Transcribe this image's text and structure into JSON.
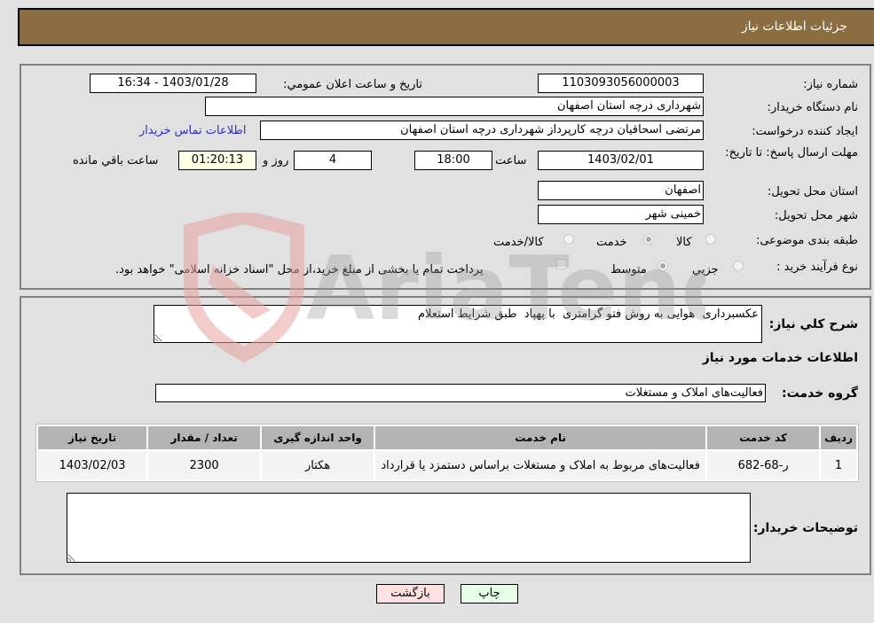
{
  "header": {
    "title": "جزئیات اطلاعات نیاز"
  },
  "details": {
    "need_number_label": "شماره نیاز:",
    "need_number": "1103093056000003",
    "announce_label": "تاریخ و ساعت اعلان عمومي:",
    "announce_value": "1403/01/28 - 16:34",
    "buyer_org_label": "نام دستگاه خریدار:",
    "buyer_org": "شهرداری درچه استان اصفهان",
    "creator_label": "ایجاد کننده درخواست:",
    "creator": "مرتضی اسحاقیان درچه کارپرداز شهرداری درچه استان اصفهان",
    "contact_link": "اطلاعات تماس خریدار",
    "deadline_label": "مهلت ارسال پاسخ: تا تاریخ:",
    "deadline_date": "1403/02/01",
    "time_label": "ساعت",
    "deadline_time": "18:00",
    "days_value": "4",
    "days_label": "روز و",
    "remaining_time": "01:20:13",
    "remaining_label": "ساعت باقي مانده",
    "province_label": "استان محل تحویل:",
    "province": "اصفهان",
    "city_label": "شهر محل تحویل:",
    "city": "خمینی شهر",
    "category_label": "طبقه بندی موضوعی:",
    "category_options": [
      {
        "label": "کالا",
        "selected": false
      },
      {
        "label": "خدمت",
        "selected": true
      },
      {
        "label": "کالا/خدمت",
        "selected": false
      }
    ],
    "process_label": "نوع فرآیند خرید :",
    "process_options": [
      {
        "label": "جزيي",
        "selected": false
      },
      {
        "label": "متوسط",
        "selected": true
      }
    ],
    "treasury_checkbox_checked": false,
    "treasury_text": "پرداخت تمام یا بخشی از مبلغ خرید،از محل \"اسناد خزانه اسلامی\" خواهد بود."
  },
  "services": {
    "description_label": "شرح کلي نیاز:",
    "description": "عکسبرداری  هوایی به روش فتو گرامتری  با پهپاد  طبق شرایط استعلام",
    "section_title": "اطلاعات خدمات مورد نیاز",
    "group_label": "گروه خدمت:",
    "group_value": "فعالیت‌های  املاک و مستغلات",
    "table": {
      "headers": [
        "ردیف",
        "کد خدمت",
        "نام خدمت",
        "واحد اندازه گیری",
        "تعداد / مقدار",
        "تاریخ نیاز"
      ],
      "rows": [
        [
          "1",
          "ر-68-682",
          "فعالیت‌های مربوط به املاک و مستغلات براساس دستمزد یا قرارداد",
          "هکتار",
          "2300",
          "1403/02/03"
        ]
      ]
    },
    "buyer_notes_label": "توضیحات خریدار:",
    "buyer_notes": ""
  },
  "buttons": {
    "print": "چاپ",
    "back": "بازگشت"
  },
  "colors": {
    "header_bg": "#8c6c41",
    "print_bg": "#e6ffe6",
    "back_bg": "#ffe0e0",
    "link": "#2d2dcc"
  },
  "watermark": {
    "text": "AriaTender.neT"
  }
}
